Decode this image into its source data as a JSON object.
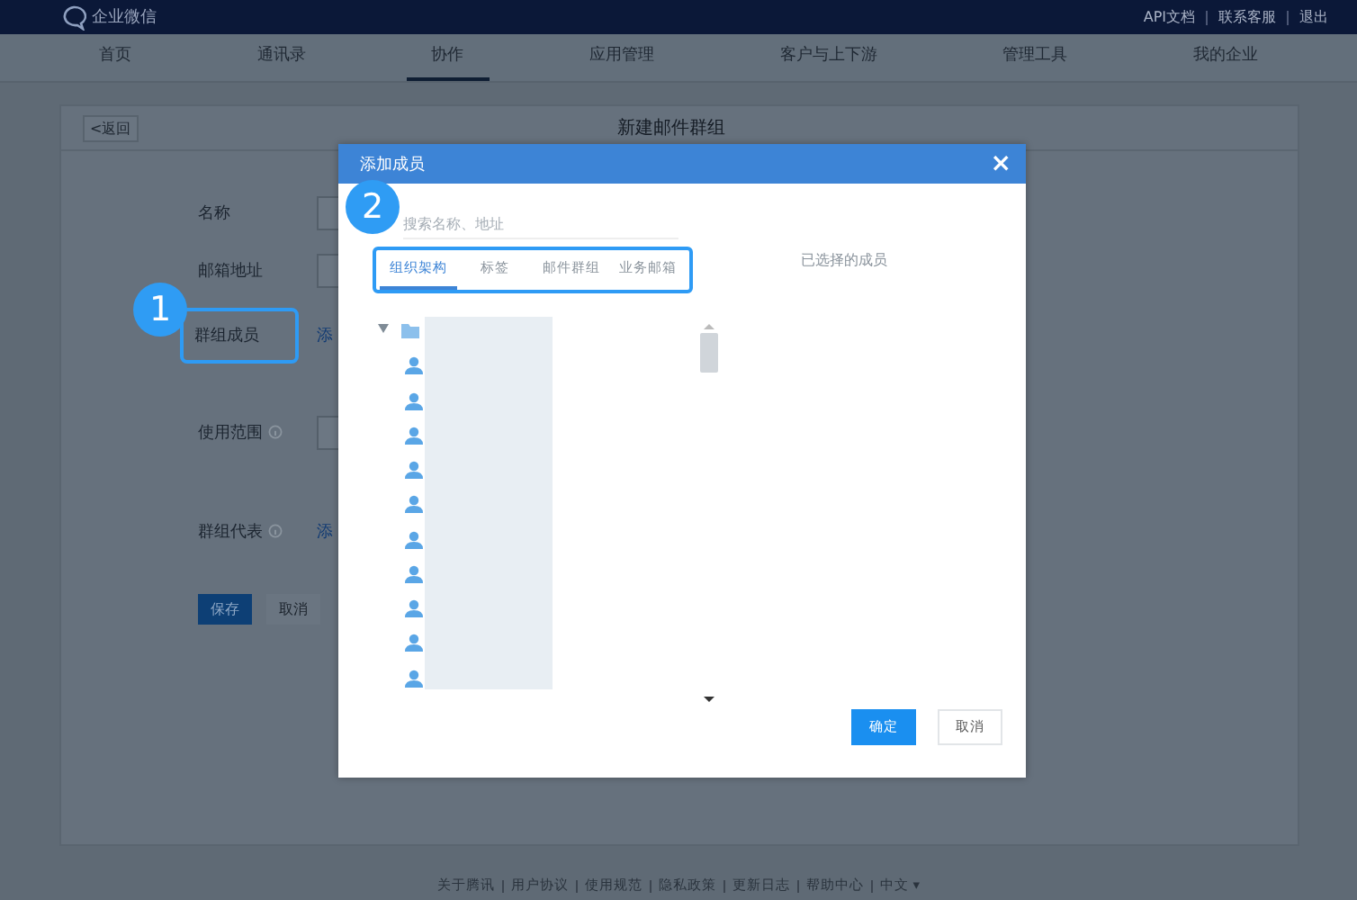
{
  "header": {
    "logo": "企业微信",
    "links": [
      "API文档",
      "联系客服",
      "退出"
    ]
  },
  "nav": [
    {
      "label": "首页",
      "selected": false
    },
    {
      "label": "通讯录",
      "selected": false
    },
    {
      "label": "协作",
      "selected": true
    },
    {
      "label": "应用管理",
      "selected": false
    },
    {
      "label": "客户与上下游",
      "selected": false
    },
    {
      "label": "管理工具",
      "selected": false
    },
    {
      "label": "我的企业",
      "selected": false
    }
  ],
  "page": {
    "back": "<返回",
    "title": "新建邮件群组",
    "fields": [
      {
        "kind": "input",
        "label": "名称"
      },
      {
        "kind": "input",
        "label": "邮箱地址"
      },
      {
        "kind": "link",
        "label": "群组成员",
        "link": "添",
        "highlighted": true
      },
      {
        "kind": "select",
        "label": "使用范围",
        "info": true
      },
      {
        "kind": "link",
        "label": "群组代表",
        "link": "添",
        "info": true,
        "highlighted": false
      }
    ],
    "buttons": [
      {
        "label": "保存",
        "primary": true
      },
      {
        "label": "取消",
        "primary": false
      }
    ]
  },
  "modal": {
    "title": "添加成员",
    "close": "×",
    "search": {
      "placeholder": "搜索名称、地址"
    },
    "tabs": [
      {
        "label": "组织架构",
        "selected": true
      },
      {
        "label": "标签",
        "selected": false
      },
      {
        "label": "邮件群组",
        "selected": false
      },
      {
        "label": "业务邮箱",
        "selected": false
      }
    ],
    "tree": {
      "expanded": true,
      "children": [
        {
          "kind": "person"
        },
        {
          "kind": "person"
        },
        {
          "kind": "person"
        },
        {
          "kind": "person"
        },
        {
          "kind": "person"
        },
        {
          "kind": "person"
        },
        {
          "kind": "person"
        },
        {
          "kind": "person"
        },
        {
          "kind": "person"
        },
        {
          "kind": "person"
        }
      ]
    },
    "selected_title": "已选择的成员",
    "buttons": [
      {
        "label": "确定",
        "primary": true
      },
      {
        "label": "取消",
        "primary": false
      }
    ]
  },
  "badges": [
    "1",
    "2"
  ],
  "footer": [
    "关于腾讯",
    "用户协议",
    "使用规范",
    "隐私政策",
    "更新日志",
    "帮助中心"
  ],
  "language": "中文 ▾"
}
